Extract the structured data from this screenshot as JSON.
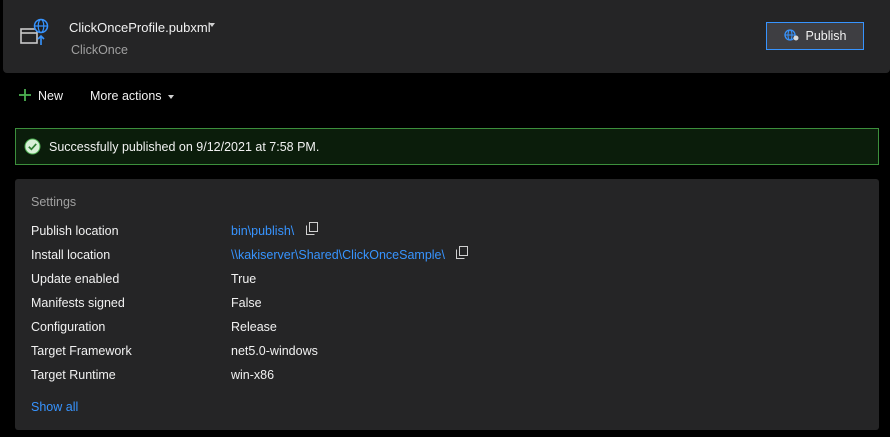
{
  "header": {
    "profile_name": "ClickOnceProfile.pubxml",
    "profile_type": "ClickOnce",
    "publish_label": "Publish"
  },
  "toolbar": {
    "new_label": "New",
    "more_actions_label": "More actions"
  },
  "banner": {
    "message": "Successfully published on 9/12/2021 at 7:58 PM.",
    "status_color": "#3c8f3c"
  },
  "settings": {
    "title": "Settings",
    "rows": [
      {
        "label": "Publish location",
        "value": "bin\\publish\\"
      },
      {
        "label": "Install location",
        "value": "\\\\kakiserver\\Shared\\ClickOnceSample\\"
      },
      {
        "label": "Update enabled",
        "value": "True"
      },
      {
        "label": "Manifests signed",
        "value": "False"
      },
      {
        "label": "Configuration",
        "value": "Release"
      },
      {
        "label": "Target Framework",
        "value": "net5.0-windows"
      },
      {
        "label": "Target Runtime",
        "value": "win-x86"
      }
    ],
    "show_all_label": "Show all"
  },
  "colors": {
    "background": "#000000",
    "panel": "#252526",
    "accent": "#3794ff",
    "success": "#4caf50"
  },
  "icons": {
    "profile": "publish-web-icon",
    "publish": "publish-icon",
    "new": "plus-icon",
    "success": "checkmark-circle-icon",
    "copy": "copy-icon"
  }
}
